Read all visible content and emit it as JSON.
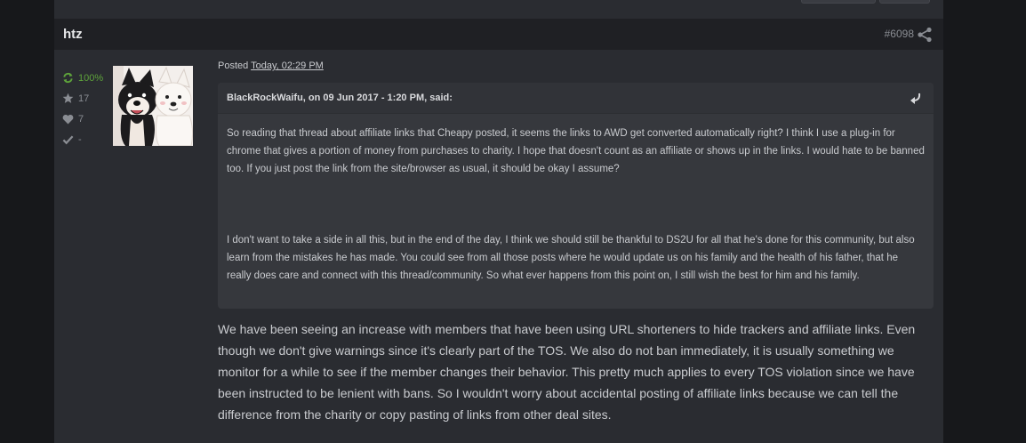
{
  "post": {
    "username": "htz",
    "post_number": "#6098",
    "posted_prefix": "Posted",
    "posted_date": "Today, 02:29 PM"
  },
  "stats": [
    {
      "icon": "refresh-icon",
      "value": "100%",
      "color": "#5ea33b"
    },
    {
      "icon": "star-icon",
      "value": "17"
    },
    {
      "icon": "heart-icon",
      "value": "7"
    },
    {
      "icon": "check-icon",
      "value": "-"
    }
  ],
  "quote": {
    "author_line": "BlackRockWaifu, on 09 Jun 2017 - 1:20 PM, said:",
    "paragraphs": [
      "So reading that thread about affiliate links that Cheapy posted, it seems the links to AWD get converted automatically right? I think I use a plug-in for chrome that gives a portion of money from purchases to charity. I hope that doesn't count as an affiliate or shows up in the links. I would hate to be banned too. If you just post the link from the site/browser as usual, it should be okay I assume?",
      "I don't want to take a side in all this, but in the end of the day, I think we should still be thankful to DS2U for all that he's done for this community, but also learn from the mistakes he has made. You could see from all those posts where he would update us on his family and the health of his father, that he really does care and connect with this thread/community. So what ever happens from this point on, I still wish the best for him and his family."
    ]
  },
  "reply": "We have been seeing an increase with members that have been using URL shorteners to hide trackers and affiliate links. Even though we don't give warnings since it's clearly part of the TOS. We also do not ban immediately, it is usually something we monitor for a while to see if the member changes their behavior. This pretty much applies to every TOS violation since we have been instructed to be lenient with bans. So I wouldn't worry about accidental posting of affiliate links because we can tell the difference from the charity or copy pasting of links from other deal sites.",
  "colors": {
    "page_bg": "#17181b",
    "panel_bg": "#2a2c31",
    "header_bg": "#1f2024",
    "quote_bg": "#36383d",
    "accent_green": "#5ea33b"
  }
}
